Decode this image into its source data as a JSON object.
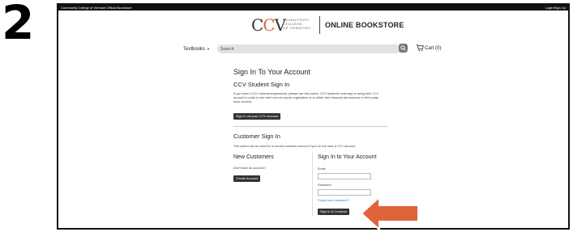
{
  "step_number": "2",
  "topbar": {
    "left_text": "Community College of Vermont Official Bookstore",
    "right_text": "Login/Sign Up"
  },
  "logo": {
    "mark_c1": "C",
    "mark_c2": "C",
    "mark_v": "V",
    "college_line1": "COMMUNITY",
    "college_line2": "COLLEGE",
    "college_line3": "OF VERMONT",
    "store_name": "ONLINE BOOKSTORE"
  },
  "nav": {
    "textbooks_label": "Textbooks",
    "search_placeholder": "Search",
    "cart_label": "Cart (0)"
  },
  "signin": {
    "page_title": "Sign In To Your Account",
    "ccv_title": "CCV Student Sign In",
    "ccv_description": "If you have a CCV username/password, please use this option. CCV students must sign in using their CCV account in order to see their current course registration or to utilize their financial aid advance or third party book voucher.",
    "ccv_button": "Sign In via your CCV Account",
    "customer_title": "Customer Sign In",
    "customer_description": "This option can be used for a normal customer account if you do not have a CCV account.",
    "new_customers_title": "New Customers",
    "new_customers_text": "Don't have an account?",
    "create_account_button": "Create Account",
    "account_title": "Sign In to Your Account",
    "email_label": "Email",
    "password_label": "Password",
    "forgot_password": "Forgot your password?",
    "sign_in_button": "Sign In & Continue"
  },
  "colors": {
    "accent_arrow": "#e1633a",
    "logo_accent": "#d2693a",
    "button_dark": "#333333"
  }
}
